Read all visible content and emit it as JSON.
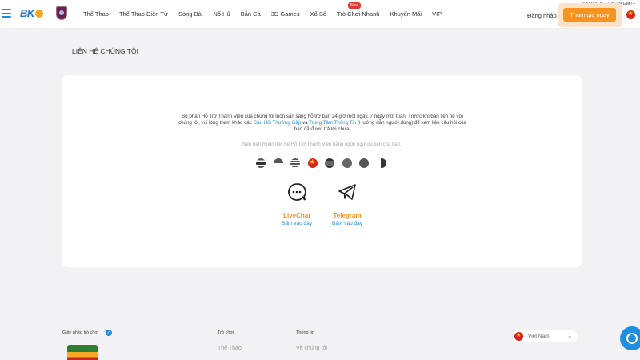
{
  "header": {
    "logo_text": "BK",
    "nav": [
      "Thể Thao",
      "Thể Thao Điện Tử",
      "Sòng Bài",
      "Nổ Hũ",
      "Bắn Cá",
      "3D Games",
      "Xổ Số",
      "Trò Chơi Nhanh",
      "Khuyến Mãi",
      "VIP"
    ],
    "new_badge": "New",
    "datetime": "20/09/2025 12:36:39 GMT+",
    "login": "Đăng nhập",
    "join": "Tham gia ngay"
  },
  "page": {
    "title": "LIÊN HỆ CHÚNG TÔI"
  },
  "card": {
    "intro_1": "Bộ phận Hỗ Trợ Thành Viên của chúng tôi luôn sẵn sàng hỗ trợ bạn 24 giờ một ngày, 7 ngày một tuần. Trước khi bạn liên hệ với chúng tôi, vui lòng tham khảo các ",
    "faq_link": "Câu Hỏi Thường Gặp",
    "and": " và ",
    "info_link": "Trung Tâm Thông Tin",
    "intro_2": " (Hướng dẫn người dùng) để xem liệu câu hỏi của bạn đã được trả lời chưa.",
    "note": "Nếu bạn muốn liên hệ Hỗ Trợ Thành Viên bằng ngôn ngữ ưu tiên của bạn.",
    "livechat_label": "LiveChat",
    "livechat_sub": "Bấm vào đây",
    "telegram_label": "Telegram",
    "telegram_sub": "Bấm vào đây"
  },
  "footer": {
    "license": "Giấy phép trò chơi",
    "games_head": "Trò chơi",
    "games_item": "Thể Thao",
    "info_head": "Thông tin",
    "info_item": "Về chúng tôi",
    "language": "Việt Nam"
  },
  "colors": {
    "accent": "#f7931e",
    "link": "#1e8fe0"
  }
}
